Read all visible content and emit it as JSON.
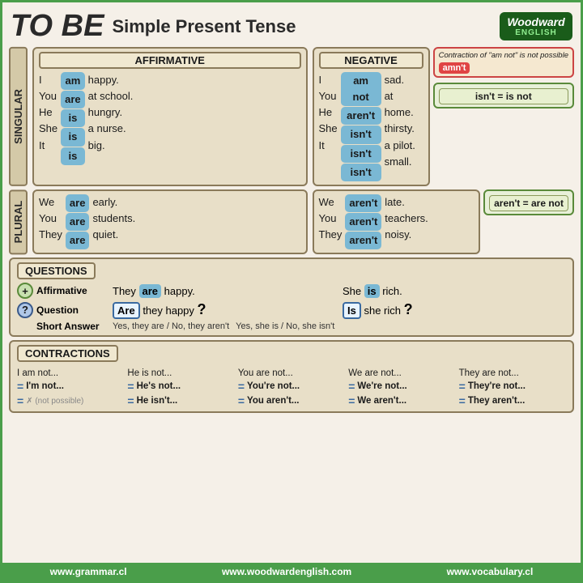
{
  "header": {
    "title_tobe": "TO BE",
    "title_subtitle": "Simple Present Tense",
    "logo_woodward": "Woodward",
    "logo_english": "ENGLISH"
  },
  "affirmative": {
    "header": "AFFIRMATIVE",
    "singular": {
      "pronouns": [
        "I",
        "You",
        "He",
        "She",
        "It"
      ],
      "verbs": [
        "am",
        "are",
        "is",
        "is",
        "is"
      ],
      "complements": [
        "happy.",
        "at school.",
        "hungry.",
        "a nurse.",
        "big."
      ]
    },
    "plural": {
      "pronouns": [
        "We",
        "You",
        "They"
      ],
      "verbs": [
        "are",
        "are",
        "are"
      ],
      "complements": [
        "early.",
        "students.",
        "quiet."
      ]
    }
  },
  "negative": {
    "header": "NEGATIVE",
    "singular": {
      "pronouns": [
        "I",
        "You",
        "He",
        "She",
        "It"
      ],
      "verbs": [
        "am not",
        "aren't",
        "isn't",
        "isn't",
        "isn't"
      ],
      "complements": [
        "sad.",
        "at home.",
        "thirsty.",
        "a pilot.",
        "small."
      ]
    },
    "plural": {
      "pronouns": [
        "We",
        "You",
        "They"
      ],
      "verbs": [
        "aren't",
        "aren't",
        "aren't"
      ],
      "complements": [
        "late.",
        "teachers.",
        "noisy."
      ]
    }
  },
  "callouts": {
    "amn_note": "Contraction of \"am not\" is not possible",
    "amn_badge": "amn't",
    "isnt_eq": "isn't = is not",
    "arent_eq": "aren't = are not"
  },
  "questions": {
    "header": "QUESTIONS",
    "affirmative_label": "Affirmative",
    "question_label": "Question",
    "short_answer_label": "Short Answer",
    "aff_left": "They",
    "aff_verb_left": "are",
    "aff_right_left": "happy.",
    "aff_mid": "She",
    "aff_verb_right": "is",
    "aff_right_right": "rich.",
    "q_left_verb": "Are",
    "q_left_rest": "they happy",
    "q_left_mark": "?",
    "q_right_verb": "Is",
    "q_right_rest": "she rich",
    "q_right_mark": "?",
    "short_left": "Yes, they are / No, they aren't",
    "short_right": "Yes, she is / No, she isn't"
  },
  "contractions": {
    "header": "CONTRACTIONS",
    "columns": [
      {
        "original": "I am not...",
        "contraction": "I'm not...",
        "xform": null
      },
      {
        "original": "He is not...",
        "contraction": "He's not...",
        "xform": "He isn't..."
      },
      {
        "original": "You are not...",
        "contraction": "You're not...",
        "xform": "You aren't..."
      },
      {
        "original": "We are not...",
        "contraction": "We're not...",
        "xform": "We aren't..."
      },
      {
        "original": "They are not...",
        "contraction": "They're not...",
        "xform": "They aren't..."
      }
    ]
  },
  "footer": {
    "link1": "www.grammar.cl",
    "link2": "www.woodwardenglish.com",
    "link3": "www.vocabulary.cl"
  }
}
